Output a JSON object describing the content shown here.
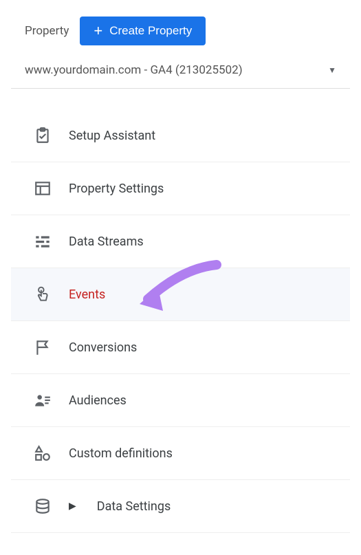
{
  "header": {
    "label": "Property",
    "create_button": "Create Property"
  },
  "selector": {
    "text": "www.yourdomain.com - GA4 (213025502)"
  },
  "menu": {
    "items": [
      {
        "id": "setup-assistant",
        "label": "Setup Assistant",
        "icon": "clipboard-check",
        "selected": false,
        "expandable": false
      },
      {
        "id": "property-settings",
        "label": "Property Settings",
        "icon": "layout",
        "selected": false,
        "expandable": false
      },
      {
        "id": "data-streams",
        "label": "Data Streams",
        "icon": "streams",
        "selected": false,
        "expandable": false
      },
      {
        "id": "events",
        "label": "Events",
        "icon": "touch",
        "selected": true,
        "expandable": false
      },
      {
        "id": "conversions",
        "label": "Conversions",
        "icon": "flag",
        "selected": false,
        "expandable": false
      },
      {
        "id": "audiences",
        "label": "Audiences",
        "icon": "audience",
        "selected": false,
        "expandable": false
      },
      {
        "id": "custom-definitions",
        "label": "Custom definitions",
        "icon": "shapes",
        "selected": false,
        "expandable": false
      },
      {
        "id": "data-settings",
        "label": "Data Settings",
        "icon": "database",
        "selected": false,
        "expandable": true
      }
    ]
  },
  "annotation": {
    "arrow_color": "#b07ff0"
  }
}
